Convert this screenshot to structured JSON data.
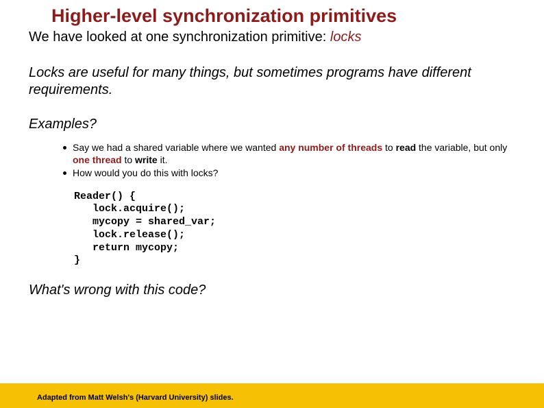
{
  "title": "Higher-level synchronization primitives",
  "intro_prefix": "We have looked at one synchronization primitive: ",
  "intro_em": "locks",
  "para1": "Locks are useful for many things, but sometimes programs have different requirements.",
  "examples_label": "Examples?",
  "bullets": [
    {
      "pre": "Say we had a shared variable where we wanted ",
      "em1": "any number of threads",
      "mid1": " to ",
      "b1": "read",
      "mid2": " the variable, but only ",
      "em2": "one thread",
      "mid3": " to ",
      "b2": "write",
      "post": " it."
    },
    {
      "text": "How would you do this with locks?"
    }
  ],
  "code": "Reader() {\n   lock.acquire();\n   mycopy = shared_var;\n   lock.release();\n   return mycopy;\n}",
  "question": "What's wrong with this code?",
  "footer": "Adapted from Matt Welsh's (Harvard University) slides."
}
